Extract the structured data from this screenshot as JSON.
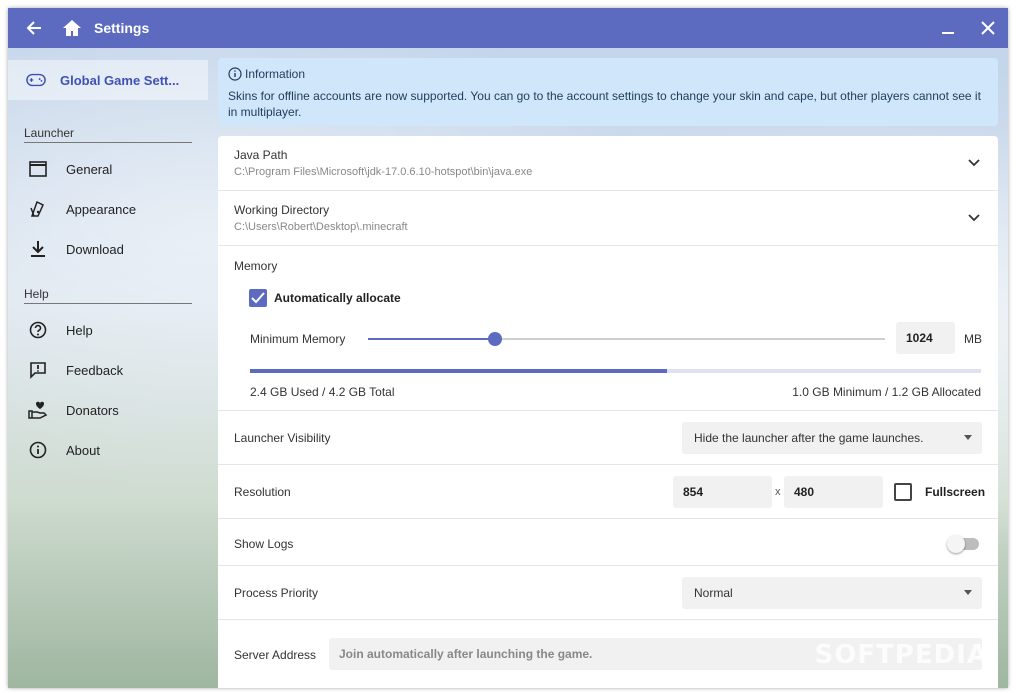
{
  "window": {
    "title": "Settings",
    "back_icon": "arrow-left-icon",
    "home_icon": "home-icon",
    "minimize_icon": "minimize-icon",
    "close_icon": "close-icon"
  },
  "sidebar": {
    "selected": {
      "label": "Global Game Sett...",
      "icon": "gamepad-icon"
    },
    "sections": [
      {
        "header": "Launcher",
        "items": [
          {
            "label": "General",
            "icon": "window-icon"
          },
          {
            "label": "Appearance",
            "icon": "palette-icon"
          },
          {
            "label": "Download",
            "icon": "download-icon"
          }
        ]
      },
      {
        "header": "Help",
        "items": [
          {
            "label": "Help",
            "icon": "question-icon"
          },
          {
            "label": "Feedback",
            "icon": "feedback-icon"
          },
          {
            "label": "Donators",
            "icon": "heart-hand-icon"
          },
          {
            "label": "About",
            "icon": "info-icon"
          }
        ]
      }
    ]
  },
  "info": {
    "title": "Information",
    "message": "Skins for offline accounts are now supported. You can go to the account settings to change your skin and cape, but other players cannot see it in multiplayer."
  },
  "settings": {
    "java_path": {
      "label": "Java Path",
      "value": "C:\\Program Files\\Microsoft\\jdk-17.0.6.10-hotspot\\bin\\java.exe"
    },
    "working_directory": {
      "label": "Working Directory",
      "value": "C:\\Users\\Robert\\Desktop\\.minecraft"
    },
    "memory": {
      "label": "Memory",
      "auto_allocate_label": "Automatically allocate",
      "auto_allocate_checked": true,
      "minimum_label": "Minimum Memory",
      "minimum_value": "1024",
      "unit": "MB",
      "slider_fraction": 0.246,
      "used_text": "2.4 GB Used / 4.2 GB Total",
      "used_fraction": 0.57,
      "allocated_text": "1.0 GB Minimum / 1.2 GB Allocated"
    },
    "launcher_visibility": {
      "label": "Launcher Visibility",
      "value": "Hide the launcher after the game launches."
    },
    "resolution": {
      "label": "Resolution",
      "width": "854",
      "separator": "x",
      "height": "480",
      "fullscreen_label": "Fullscreen",
      "fullscreen_checked": false
    },
    "show_logs": {
      "label": "Show Logs",
      "enabled": false
    },
    "process_priority": {
      "label": "Process Priority",
      "value": "Normal"
    },
    "server_address": {
      "label": "Server Address",
      "placeholder": "Join automatically after launching the game."
    }
  },
  "watermark": "SOFTPEDIA",
  "colors": {
    "accent": "#5c6bc0",
    "info_bg": "#cfe6fb"
  }
}
